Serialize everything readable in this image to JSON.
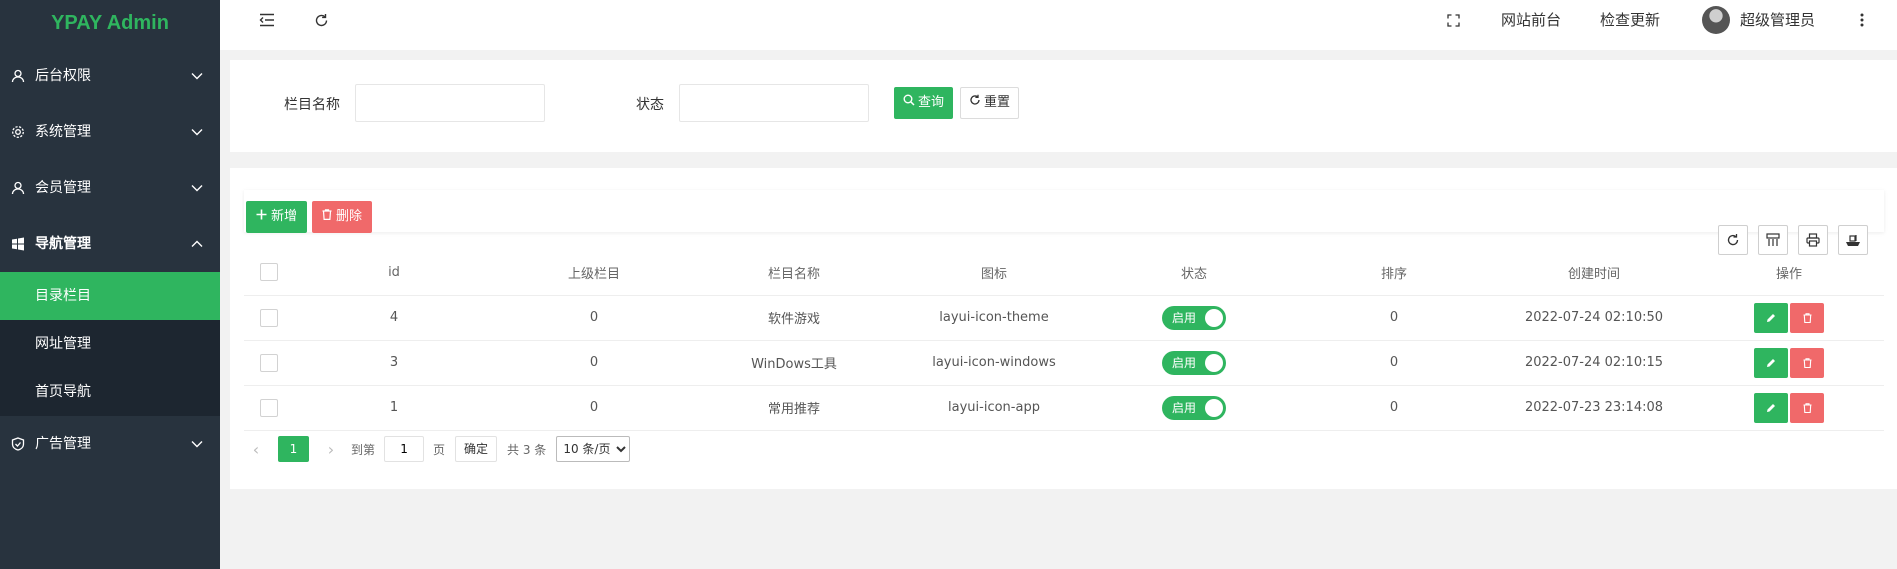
{
  "brand": "YPAY Admin",
  "header": {
    "site_front": "网站前台",
    "check_update": "检查更新",
    "user": "超级管理员"
  },
  "sidebar": {
    "groups": [
      {
        "label": "后台权限",
        "icon": "user-icon"
      },
      {
        "label": "系统管理",
        "icon": "gear-icon"
      },
      {
        "label": "会员管理",
        "icon": "user-icon"
      },
      {
        "label": "导航管理",
        "icon": "windows-icon",
        "expanded": true,
        "items": [
          {
            "label": "目录栏目",
            "active": true
          },
          {
            "label": "网址管理"
          },
          {
            "label": "首页导航"
          }
        ]
      },
      {
        "label": "广告管理",
        "icon": "shield-icon"
      }
    ]
  },
  "search": {
    "name_label": "栏目名称",
    "status_label": "状态",
    "name_value": "",
    "status_value": "",
    "search_btn": "查询",
    "reset_btn": "重置"
  },
  "toolbar": {
    "add_btn": "新增",
    "delete_btn": "删除"
  },
  "table": {
    "columns": [
      "id",
      "上级栏目",
      "栏目名称",
      "图标",
      "状态",
      "排序",
      "创建时间",
      "操作"
    ],
    "rows": [
      {
        "id": "4",
        "parent": "0",
        "name": "软件游戏",
        "icon": "layui-icon-theme",
        "status": "启用",
        "sort": "0",
        "created": "2022-07-24 02:10:50"
      },
      {
        "id": "3",
        "parent": "0",
        "name": "WinDows工具",
        "icon": "layui-icon-windows",
        "status": "启用",
        "sort": "0",
        "created": "2022-07-24 02:10:15"
      },
      {
        "id": "1",
        "parent": "0",
        "name": "常用推荐",
        "icon": "layui-icon-app",
        "status": "启用",
        "sort": "0",
        "created": "2022-07-23 23:14:08"
      }
    ]
  },
  "pager": {
    "current": "1",
    "goto_label": "到第",
    "goto_value": "1",
    "page_unit": "页",
    "confirm": "确定",
    "total": "共 3 条",
    "page_size": "10 条/页"
  },
  "colors": {
    "accent": "#2fb55f",
    "danger": "#f0696a",
    "sidebar_bg": "#28333e",
    "submenu_bg": "#1d2630"
  }
}
